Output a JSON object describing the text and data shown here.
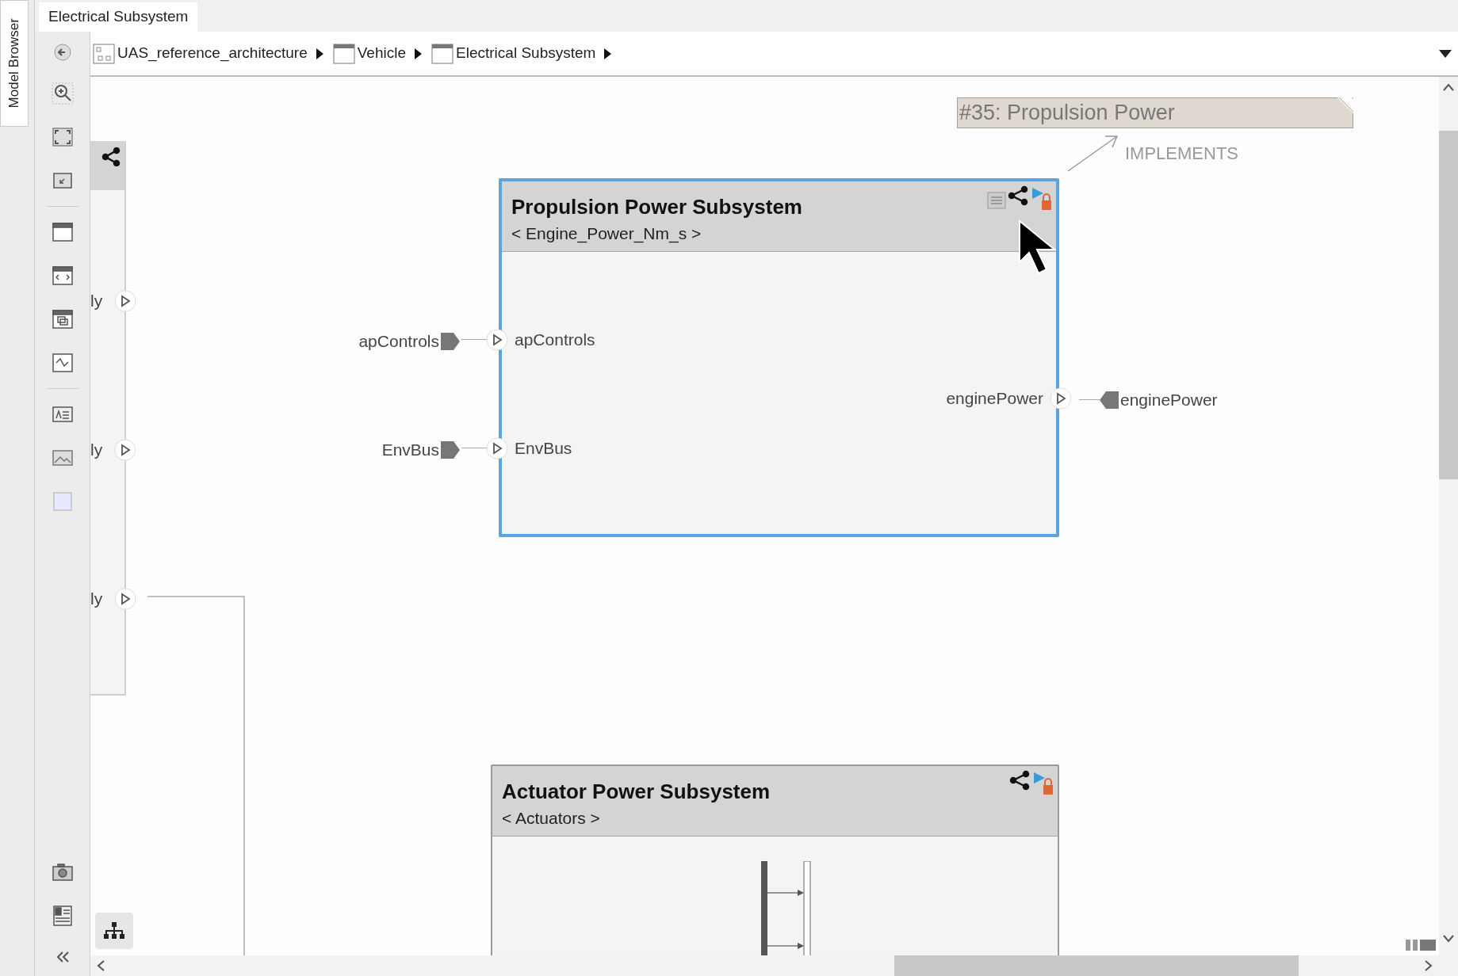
{
  "side_tab": {
    "label": "Model Browser"
  },
  "editor_tab": {
    "label": "Electrical Subsystem",
    "selected": true
  },
  "breadcrumbs": [
    {
      "kind": "model",
      "label": "UAS_reference_architecture"
    },
    {
      "kind": "component",
      "label": "Vehicle"
    },
    {
      "kind": "component",
      "label": "Electrical Subsystem"
    }
  ],
  "requirement": {
    "label": "#35: Propulsion Power",
    "link": "IMPLEMENTS"
  },
  "partial_block": {
    "ports": [
      "ly",
      "ly",
      "ly"
    ]
  },
  "blocks": [
    {
      "title": "Propulsion Power Subsystem",
      "stereotype": "< Engine_Power_Nm_s >",
      "selected": true,
      "inputs": [
        {
          "name": "apControls",
          "external": "apControls"
        },
        {
          "name": "EnvBus",
          "external": "EnvBus"
        }
      ],
      "outputs": [
        {
          "name": "enginePower",
          "external": "enginePower"
        }
      ]
    },
    {
      "title": "Actuator Power Subsystem",
      "stereotype": "< Actuators >",
      "selected": false
    }
  ]
}
